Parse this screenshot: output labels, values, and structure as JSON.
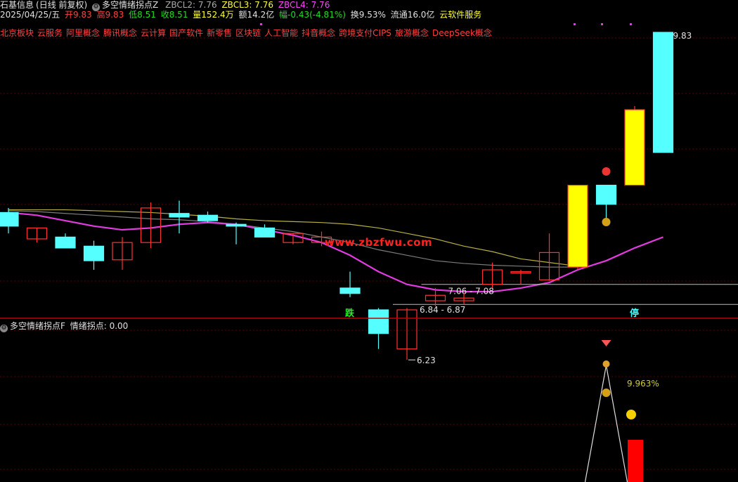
{
  "header": {
    "stock_name": "石基信息",
    "period": "(日线 前复权)",
    "indicator_name": "多空情绪拐点Z",
    "zbcl2": "ZBCL2: 7.76",
    "zbcl3": "ZBCL3: 7.76",
    "zbcl4": "ZBCL4: 7.76",
    "date": "2025/04/25/五",
    "open": "开9.83",
    "high": "高9.83",
    "low": "低8.51",
    "close": "收8.51",
    "volume": "量152.4万",
    "amount": "额14.2亿",
    "change": "幅-0.43(-4.81%)",
    "turnover": "换9.53%",
    "float": "流通16.0亿",
    "sector": "云软件服务"
  },
  "concepts": [
    "北京板块",
    "云服务",
    "阿里概念",
    "腾讯概念",
    "云计算",
    "国产软件",
    "新零售",
    "区块链",
    "人工智能",
    "抖音概念",
    "跨境支付CIPS",
    "旅游概念",
    "DeepSeek概念"
  ],
  "sub_header": {
    "indicator_name": "多空情绪拐点F",
    "value": "情绪拐点: 0.00"
  },
  "watermark": "www.zbzfwu.com",
  "colors": {
    "up": "#ff3333",
    "down": "#55ffff",
    "limit_up": "#ffff00",
    "ma_magenta": "#e23be0",
    "ma_yellow": "#b8b040",
    "ma_gray": "#7c7c7c",
    "grid": "#5a0000",
    "bar_red": "#ff0000"
  },
  "chart_data": [
    {
      "type": "candlestick",
      "title": "",
      "ylim": [
        6.0,
        10.0
      ],
      "candles": [
        {
          "o": 7.85,
          "h": 7.9,
          "l": 7.62,
          "c": 7.7
        },
        {
          "o": 7.56,
          "h": 7.68,
          "l": 7.52,
          "c": 7.68
        },
        {
          "o": 7.58,
          "h": 7.62,
          "l": 7.46,
          "c": 7.46
        },
        {
          "o": 7.48,
          "h": 7.54,
          "l": 7.22,
          "c": 7.32
        },
        {
          "o": 7.33,
          "h": 7.58,
          "l": 7.22,
          "c": 7.52
        },
        {
          "o": 7.52,
          "h": 7.96,
          "l": 7.46,
          "c": 7.9
        },
        {
          "o": 7.84,
          "h": 7.98,
          "l": 7.62,
          "c": 7.8
        },
        {
          "o": 7.82,
          "h": 7.86,
          "l": 7.74,
          "c": 7.76
        },
        {
          "o": 7.72,
          "h": 7.74,
          "l": 7.5,
          "c": 7.7
        },
        {
          "o": 7.68,
          "h": 7.72,
          "l": 7.58,
          "c": 7.58
        },
        {
          "o": 7.52,
          "h": 7.62,
          "l": 7.5,
          "c": 7.62
        },
        {
          "o": 7.52,
          "h": 7.64,
          "l": 7.48,
          "c": 7.58
        },
        {
          "o": 7.02,
          "h": 7.2,
          "l": 6.92,
          "c": 6.96
        },
        {
          "o": 6.78,
          "h": 6.8,
          "l": 6.35,
          "c": 6.52
        },
        {
          "o": 6.35,
          "h": 6.8,
          "l": 6.23,
          "c": 6.78
        },
        {
          "o": 6.88,
          "h": 7.02,
          "l": 6.82,
          "c": 6.94
        },
        {
          "o": 6.88,
          "h": 6.96,
          "l": 6.84,
          "c": 6.91
        },
        {
          "o": 7.06,
          "h": 7.3,
          "l": 7.02,
          "c": 7.22
        },
        {
          "o": 7.2,
          "h": 7.22,
          "l": 7.06,
          "c": 7.2
        },
        {
          "o": 7.11,
          "h": 7.62,
          "l": 7.1,
          "c": 7.41
        },
        {
          "o": 7.25,
          "h": 8.15,
          "l": 7.22,
          "c": 8.15
        },
        {
          "o": 8.15,
          "h": 8.15,
          "l": 7.78,
          "c": 7.94
        },
        {
          "o": 8.15,
          "h": 9.02,
          "l": 8.15,
          "c": 8.98
        },
        {
          "o": 9.83,
          "h": 9.83,
          "l": 8.51,
          "c": 8.51
        }
      ],
      "ma_magenta": [
        7.85,
        7.82,
        7.76,
        7.7,
        7.66,
        7.68,
        7.72,
        7.74,
        7.72,
        7.66,
        7.6,
        7.52,
        7.38,
        7.2,
        7.06,
        7.0,
        6.98,
        6.98,
        7.02,
        7.08,
        7.22,
        7.32,
        7.46,
        7.58
      ],
      "ma_yellow": [
        7.88,
        7.88,
        7.88,
        7.87,
        7.86,
        7.85,
        7.83,
        7.81,
        7.78,
        7.76,
        7.75,
        7.74,
        7.72,
        7.68,
        7.62,
        7.56,
        7.48,
        7.42,
        7.34,
        7.3,
        7.26
      ],
      "ma_gray": [
        7.87,
        7.86,
        7.84,
        7.82,
        7.8,
        7.78,
        7.77,
        7.75,
        7.72,
        7.68,
        7.64,
        7.58,
        7.52,
        7.44,
        7.38,
        7.32,
        7.29,
        7.27,
        7.26,
        7.25,
        7.25
      ],
      "levels": [
        {
          "value": 7.06,
          "label": "7.06 - 7.08",
          "from_index": 15
        },
        {
          "value": 6.84,
          "label": "6.84 - 6.87",
          "from_index": 14
        }
      ],
      "annotations": [
        {
          "type": "low",
          "index": 14,
          "value": 6.23,
          "label": "6.23"
        },
        {
          "type": "high",
          "index": 23,
          "value": 9.83,
          "label": "9.83"
        },
        {
          "type": "marker",
          "index": 12,
          "label": "跌"
        },
        {
          "type": "marker",
          "index": 22,
          "label": "停"
        }
      ]
    },
    {
      "type": "indicator",
      "title": "情绪拐点",
      "value": 0.0,
      "peak_index": 21,
      "label": "9.963%",
      "bar_index": 22
    }
  ]
}
